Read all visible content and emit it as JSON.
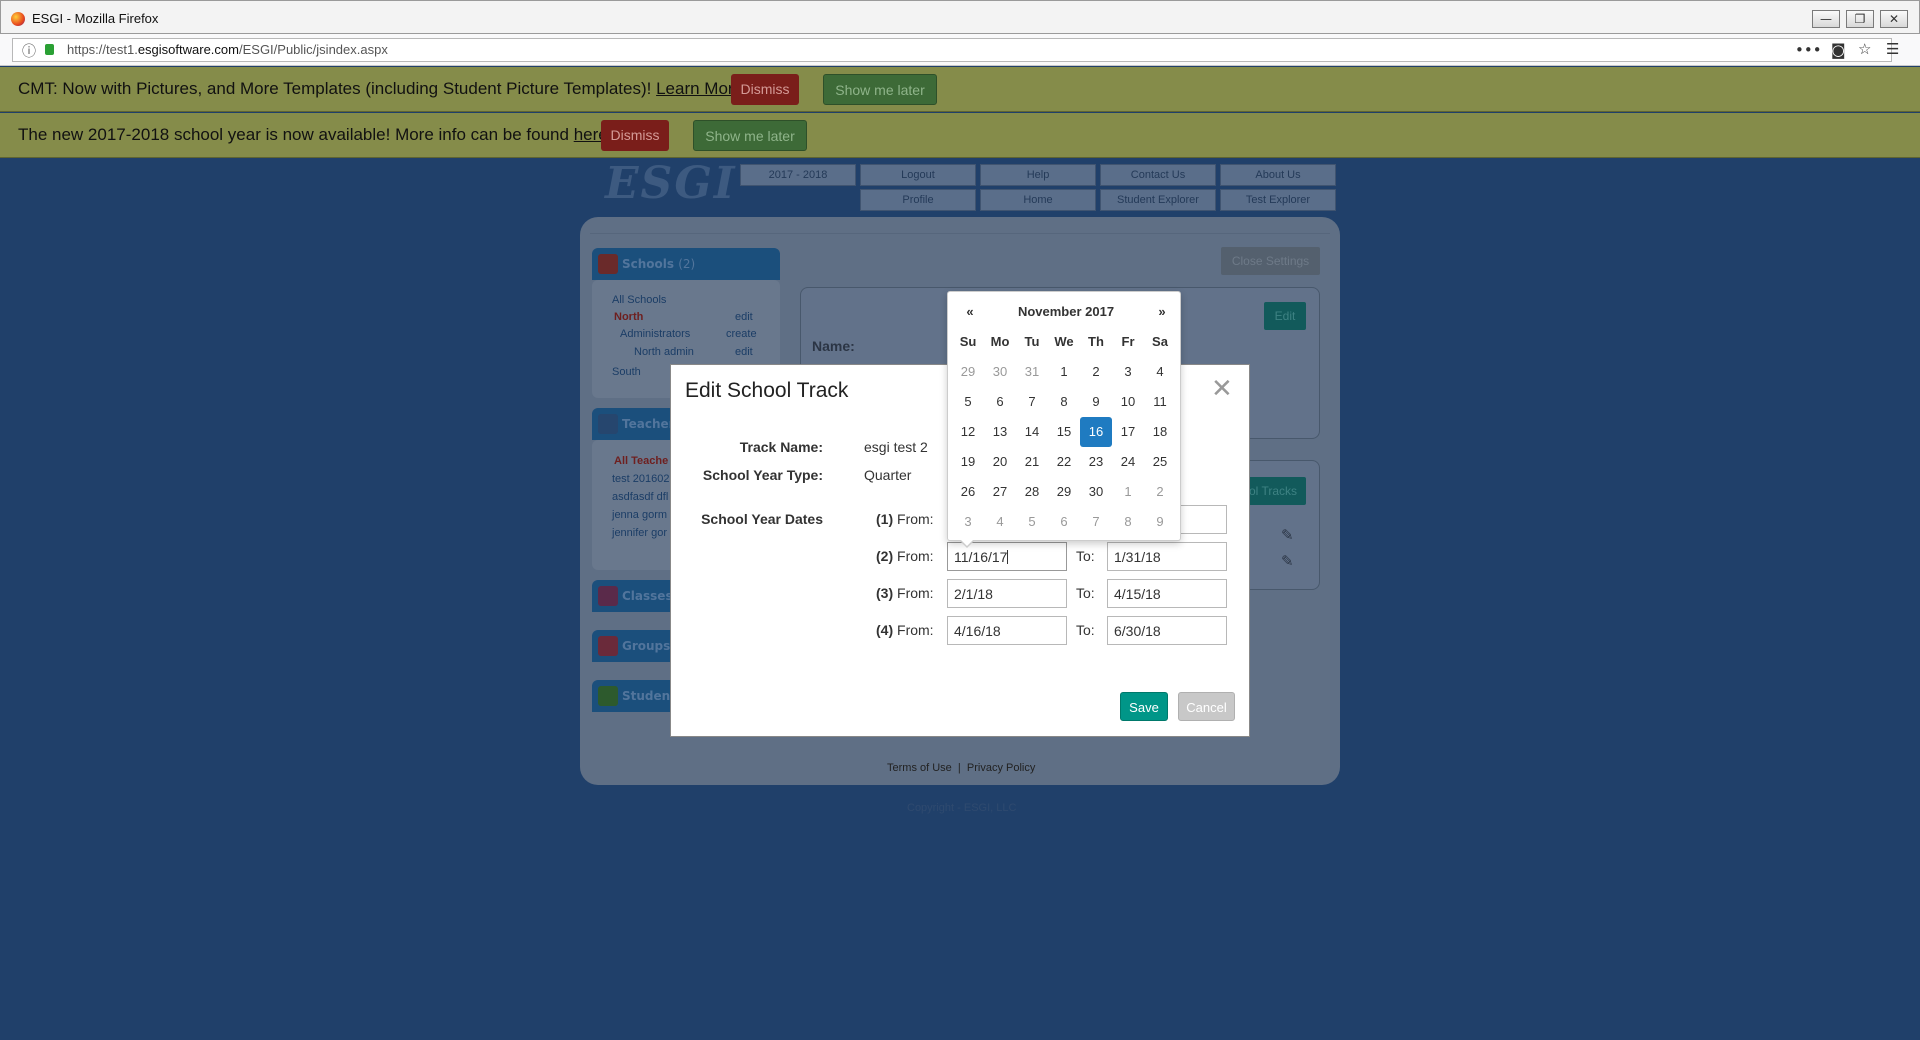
{
  "browser": {
    "window_title": "ESGI - Mozilla Firefox",
    "url_prefix": "https://test1.",
    "url_domain": "esgisoftware.com",
    "url_path": "/ESGI/Public/jsindex.aspx",
    "controls": {
      "minimize": "—",
      "maximize": "❐",
      "close": "✕"
    },
    "toolbar": {
      "more": "•••",
      "pocket": "◙",
      "bookmark": "☆",
      "menu": "☰"
    }
  },
  "notices": [
    {
      "text": "CMT: Now with Pictures, and More Templates (including Student Picture Templates)! ",
      "link": "Learn More",
      "suffix": ".",
      "dismiss": "Dismiss",
      "later": "Show me later"
    },
    {
      "text": "The new 2017-2018 school year is now available! More info can be found ",
      "link": "here",
      "suffix": ".",
      "dismiss": "Dismiss",
      "later": "Show me later"
    }
  ],
  "site": {
    "logo": "ESGI",
    "nav_top": [
      "2017 - 2018",
      "Logout",
      "Help",
      "Contact Us",
      "About Us"
    ],
    "nav_bottom": [
      "Profile",
      "Home",
      "Student Explorer",
      "Test Explorer"
    ],
    "close_settings": "Close Settings",
    "edit": "Edit",
    "name_label": "Name:",
    "tracks_btn": "ol Tracks",
    "footer_terms": "Terms of Use",
    "footer_sep": "|",
    "footer_privacy": "Privacy Policy",
    "copyright": "Copyright - ESGI, LLC"
  },
  "sidebar": {
    "schools_header": "Schools",
    "schools_count": "(2)",
    "schools": [
      "All Schools",
      "North",
      "Administrators",
      "North admin",
      "South"
    ],
    "school_actions": [
      "edit",
      "create",
      "edit"
    ],
    "teachers_header": "Teachers",
    "teachers": [
      "All Teache",
      "test 201602",
      "asdfasdf dfl",
      "jenna gorm",
      "jennifer gor"
    ],
    "classes_header": "Classes",
    "groups_header": "Groups",
    "students_header": "Student"
  },
  "modal": {
    "title": "Edit School Track",
    "close": "✕",
    "track_name_label": "Track Name:",
    "track_name_value": "esgi test 2",
    "year_type_label": "School Year Type:",
    "year_type_value": "Quarter",
    "dates_label": "School Year Dates",
    "from_label": "From:",
    "to_label": "To:",
    "periods": [
      {
        "num": "(1)",
        "from": "",
        "to": ""
      },
      {
        "num": "(2)",
        "from": "11/16/17",
        "to": "1/31/18"
      },
      {
        "num": "(3)",
        "from": "2/1/18",
        "to": "4/15/18"
      },
      {
        "num": "(4)",
        "from": "4/16/18",
        "to": "6/30/18"
      }
    ],
    "save": "Save",
    "cancel": "Cancel"
  },
  "datepicker": {
    "prev": "«",
    "next": "»",
    "month": "November 2017",
    "dow": [
      "Su",
      "Mo",
      "Tu",
      "We",
      "Th",
      "Fr",
      "Sa"
    ],
    "days": [
      [
        "29",
        "30",
        "31",
        "1",
        "2",
        "3",
        "4"
      ],
      [
        "5",
        "6",
        "7",
        "8",
        "9",
        "10",
        "11"
      ],
      [
        "12",
        "13",
        "14",
        "15",
        "16",
        "17",
        "18"
      ],
      [
        "19",
        "20",
        "21",
        "22",
        "23",
        "24",
        "25"
      ],
      [
        "26",
        "27",
        "28",
        "29",
        "30",
        "1",
        "2"
      ],
      [
        "3",
        "4",
        "5",
        "6",
        "7",
        "8",
        "9"
      ]
    ],
    "selected": "16",
    "accent_color": "#1f7bc1"
  }
}
